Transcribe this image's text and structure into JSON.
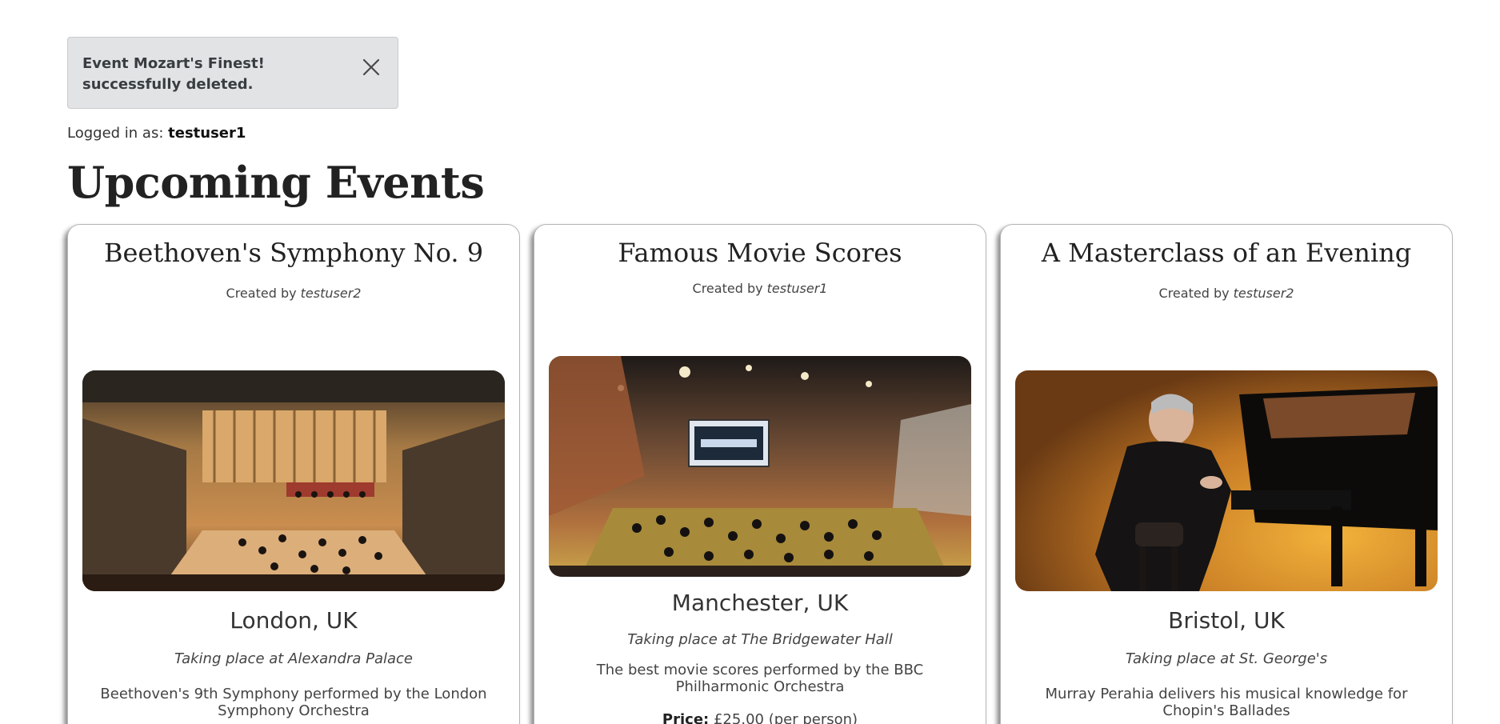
{
  "alert": {
    "message": "Event Mozart's Finest! successfully deleted."
  },
  "session": {
    "prefix": "Logged in as:",
    "username": "testuser1"
  },
  "page": {
    "title": "Upcoming Events"
  },
  "events": [
    {
      "title": "Beethoven's Symphony No. 9",
      "created_prefix": "Created by",
      "creator": "testuser2",
      "city": "London, UK",
      "venue": "Taking place at Alexandra Palace",
      "description": "Beethoven's 9th Symphony performed by the London Symphony Orchestra"
    },
    {
      "title": "Famous Movie Scores",
      "created_prefix": "Created by",
      "creator": "testuser1",
      "city": "Manchester, UK",
      "venue": "Taking place at The Bridgewater Hall",
      "description": "The best movie scores performed by the BBC Philharmonic Orchestra",
      "price_label": "Price:",
      "price_value": "£25.00 (per person)"
    },
    {
      "title": "A Masterclass of an Evening",
      "created_prefix": "Created by",
      "creator": "testuser2",
      "city": "Bristol, UK",
      "venue": "Taking place at St. George's",
      "description": "Murray Perahia delivers his musical knowledge for Chopin's Ballades"
    }
  ],
  "icons": {
    "close": "close-icon"
  }
}
